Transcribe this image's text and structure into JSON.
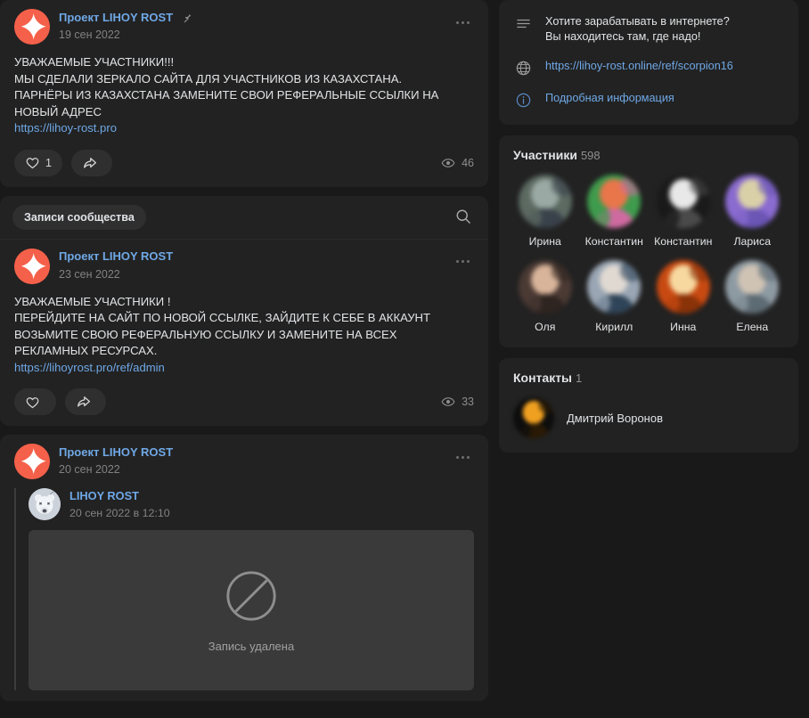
{
  "theme": {
    "page_bg": "#19191a",
    "card_bg": "#222222",
    "text": "#e1e3e6",
    "link": "#6fa8e6",
    "muted": "#828282",
    "accent_avatar": "#f4604a"
  },
  "feed": {
    "posts": [
      {
        "author": "Проект LIHOY ROST",
        "pinned": true,
        "pin_icon": "pin-icon",
        "date": "19 сен 2022",
        "text": "УВАЖАЕМЫЕ УЧАСТНИКИ!!!\nМЫ СДЕЛАЛИ ЗЕРКАЛО САЙТА ДЛЯ УЧАСТНИКОВ ИЗ КАЗАХСТАНА.\nПАРНЁРЫ ИЗ КАЗАХСТАНА ЗАМЕНИТЕ СВОИ РЕФЕРАЛЬНЫЕ ССЫЛКИ НА НОВЫЙ АДРЕС",
        "link": "https://lihoy-rost.pro",
        "like_count": "1",
        "view_count": "46",
        "like_icon": "heart-icon",
        "share_icon": "share-icon",
        "views_icon": "eye-icon",
        "more_icon": "more-options-icon"
      },
      {
        "author": "Проект LIHOY ROST",
        "pinned": false,
        "date": "23 сен 2022",
        "text": "УВАЖАЕМЫЕ УЧАСТНИКИ !\nПЕРЕЙДИТЕ НА САЙТ ПО НОВОЙ ССЫЛКЕ, ЗАЙДИТЕ К СЕБЕ В АККАУНТ\nВОЗЬМИТЕ СВОЮ РЕФЕРАЛЬНУЮ ССЫЛКУ И ЗАМЕНИТЕ НА ВСЕХ РЕКЛАМНЫХ РЕСУРСАХ.",
        "link": "https://lihoyrost.pro/ref/admin",
        "like_count": "",
        "view_count": "33",
        "like_icon": "heart-icon",
        "share_icon": "share-icon",
        "views_icon": "eye-icon",
        "more_icon": "more-options-icon"
      },
      {
        "author": "Проект LIHOY ROST",
        "pinned": false,
        "date": "20 сен 2022",
        "more_icon": "more-options-icon",
        "repost": {
          "author": "LIHOY ROST",
          "date": "20 сен 2022 в 12:10",
          "deleted_label": "Запись удалена",
          "deleted_icon": "no-entry-icon"
        }
      }
    ],
    "filter_bar": {
      "chip_label": "Записи сообщества",
      "search_icon": "search-icon"
    }
  },
  "sidebar": {
    "info": {
      "description_icon": "lines-icon",
      "description": "Хотите зарабатывать в интернете?\nВы находитесь там, где надо!",
      "website_icon": "globe-icon",
      "website": "https://lihoy-rost.online/ref/scorpion16",
      "details_icon": "info-circle-icon",
      "details_label": "Подробная информация"
    },
    "members": {
      "title": "Участники",
      "count": "598",
      "list": [
        {
          "name": "Ирина",
          "c1": "#5c6a62",
          "c2": "#9aa9a3",
          "c3": "#39414a"
        },
        {
          "name": "Константин",
          "c1": "#3f9b4d",
          "c2": "#e8764a",
          "c3": "#cf6aa0"
        },
        {
          "name": "Константин",
          "c1": "#1a1a1a",
          "c2": "#e8e8e8",
          "c3": "#4a4a4a"
        },
        {
          "name": "Лариса",
          "c1": "#8a6bd0",
          "c2": "#d9d0a8",
          "c3": "#6b55b5"
        },
        {
          "name": "Оля",
          "c1": "#4b3a34",
          "c2": "#d8b49a",
          "c3": "#2e2420"
        },
        {
          "name": "Кирилл",
          "c1": "#9aa6b4",
          "c2": "#e0d9d2",
          "c3": "#2f4458"
        },
        {
          "name": "Инна",
          "c1": "#c84a12",
          "c2": "#f7d9a0",
          "c3": "#8a3208"
        },
        {
          "name": "Елена",
          "c1": "#8e9aa2",
          "c2": "#cfc3b4",
          "c3": "#5d6b74"
        }
      ]
    },
    "contacts": {
      "title": "Контакты",
      "count": "1",
      "list": [
        {
          "name": "Дмитрий Воронов",
          "c1": "#0d0d0d",
          "c2": "#f0a020",
          "c3": "#2a1a05"
        }
      ]
    }
  }
}
